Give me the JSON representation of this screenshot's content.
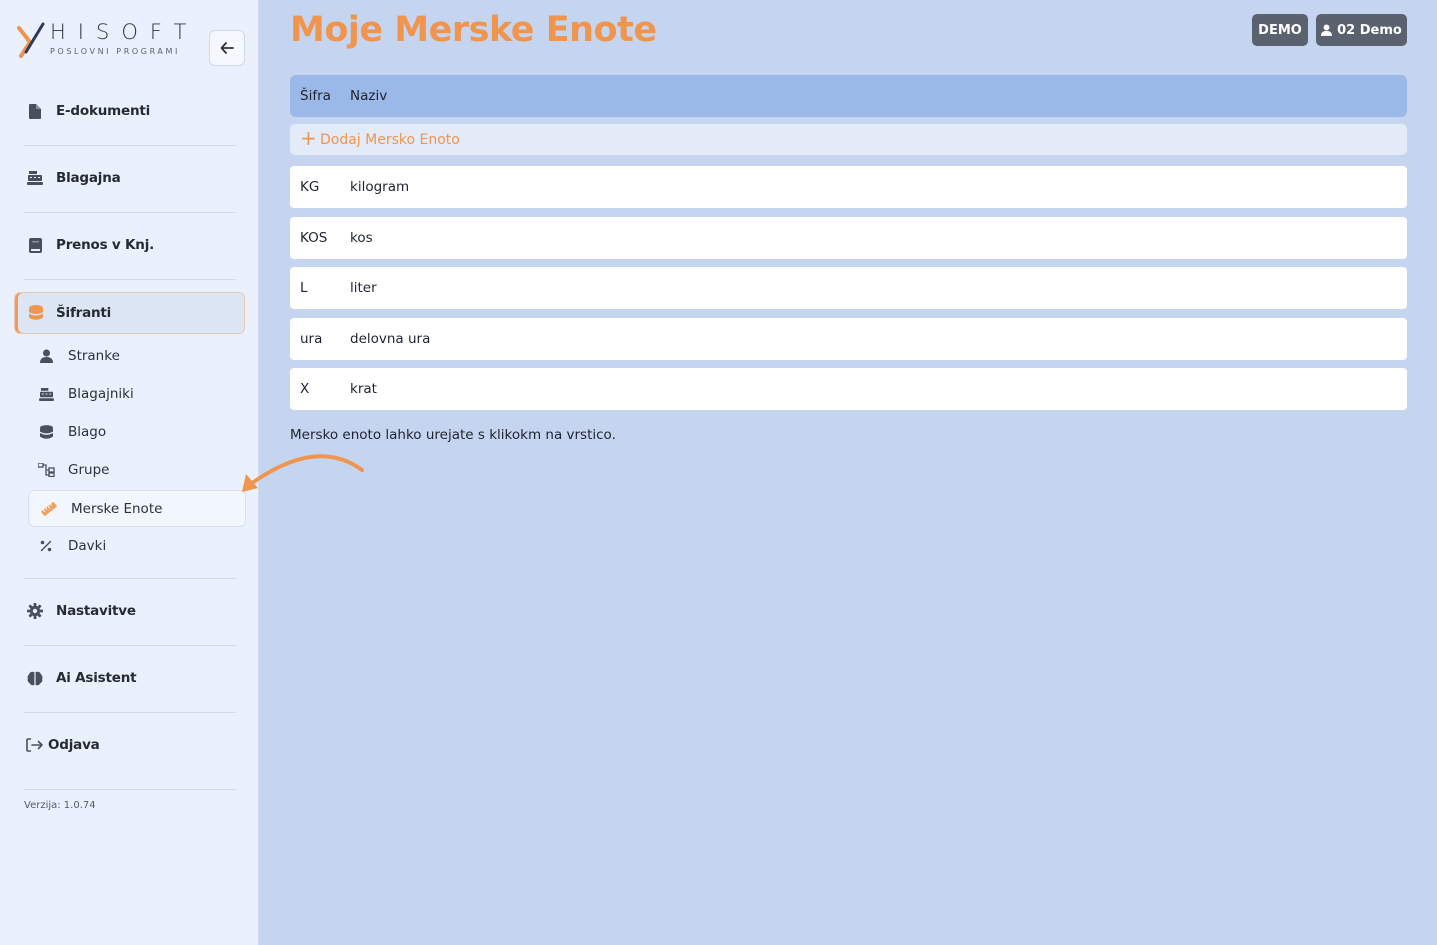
{
  "brand": {
    "name": "HISOFT",
    "tagline": "POSLOVNI PROGRAMI"
  },
  "sidebar": {
    "main_items": [
      {
        "label": "E-dokumenti",
        "icon": "document-icon"
      },
      {
        "label": "Blagajna",
        "icon": "cash-register-icon"
      },
      {
        "label": "Prenos v Knj.",
        "icon": "book-icon"
      },
      {
        "label": "Šifranti",
        "icon": "database-icon"
      },
      {
        "label": "Nastavitve",
        "icon": "gear-icon"
      },
      {
        "label": "Ai Asistent",
        "icon": "brain-icon"
      },
      {
        "label": "Odjava",
        "icon": "logout-icon"
      }
    ],
    "sub_items": [
      {
        "label": "Stranke",
        "icon": "user-icon"
      },
      {
        "label": "Blagajniki",
        "icon": "cash-register-icon"
      },
      {
        "label": "Blago",
        "icon": "database-icon"
      },
      {
        "label": "Grupe",
        "icon": "sitemap-icon"
      },
      {
        "label": "Merske Enote",
        "icon": "ruler-icon"
      },
      {
        "label": "Davki",
        "icon": "percent-icon"
      }
    ],
    "version": "Verzija: 1.0.74"
  },
  "header": {
    "title": "Moje Merske Enote",
    "demo_label": "DEMO",
    "user_label": "02 Demo"
  },
  "table": {
    "columns": [
      "Šifra",
      "Naziv"
    ],
    "add_label": "Dodaj Mersko Enoto",
    "rows": [
      {
        "code": "KG",
        "name": "kilogram"
      },
      {
        "code": "KOS",
        "name": "kos"
      },
      {
        "code": "L",
        "name": "liter"
      },
      {
        "code": "ura",
        "name": "delovna ura"
      },
      {
        "code": "X",
        "name": "krat"
      }
    ]
  },
  "hint": "Mersko enoto lahko urejate s klikokm na vrstico.",
  "colors": {
    "accent": "#f0954d",
    "background": "#c5d5f0",
    "sidebar": "#eaf1fd",
    "header_row": "#9ab8e8",
    "button": "#5a6270"
  }
}
